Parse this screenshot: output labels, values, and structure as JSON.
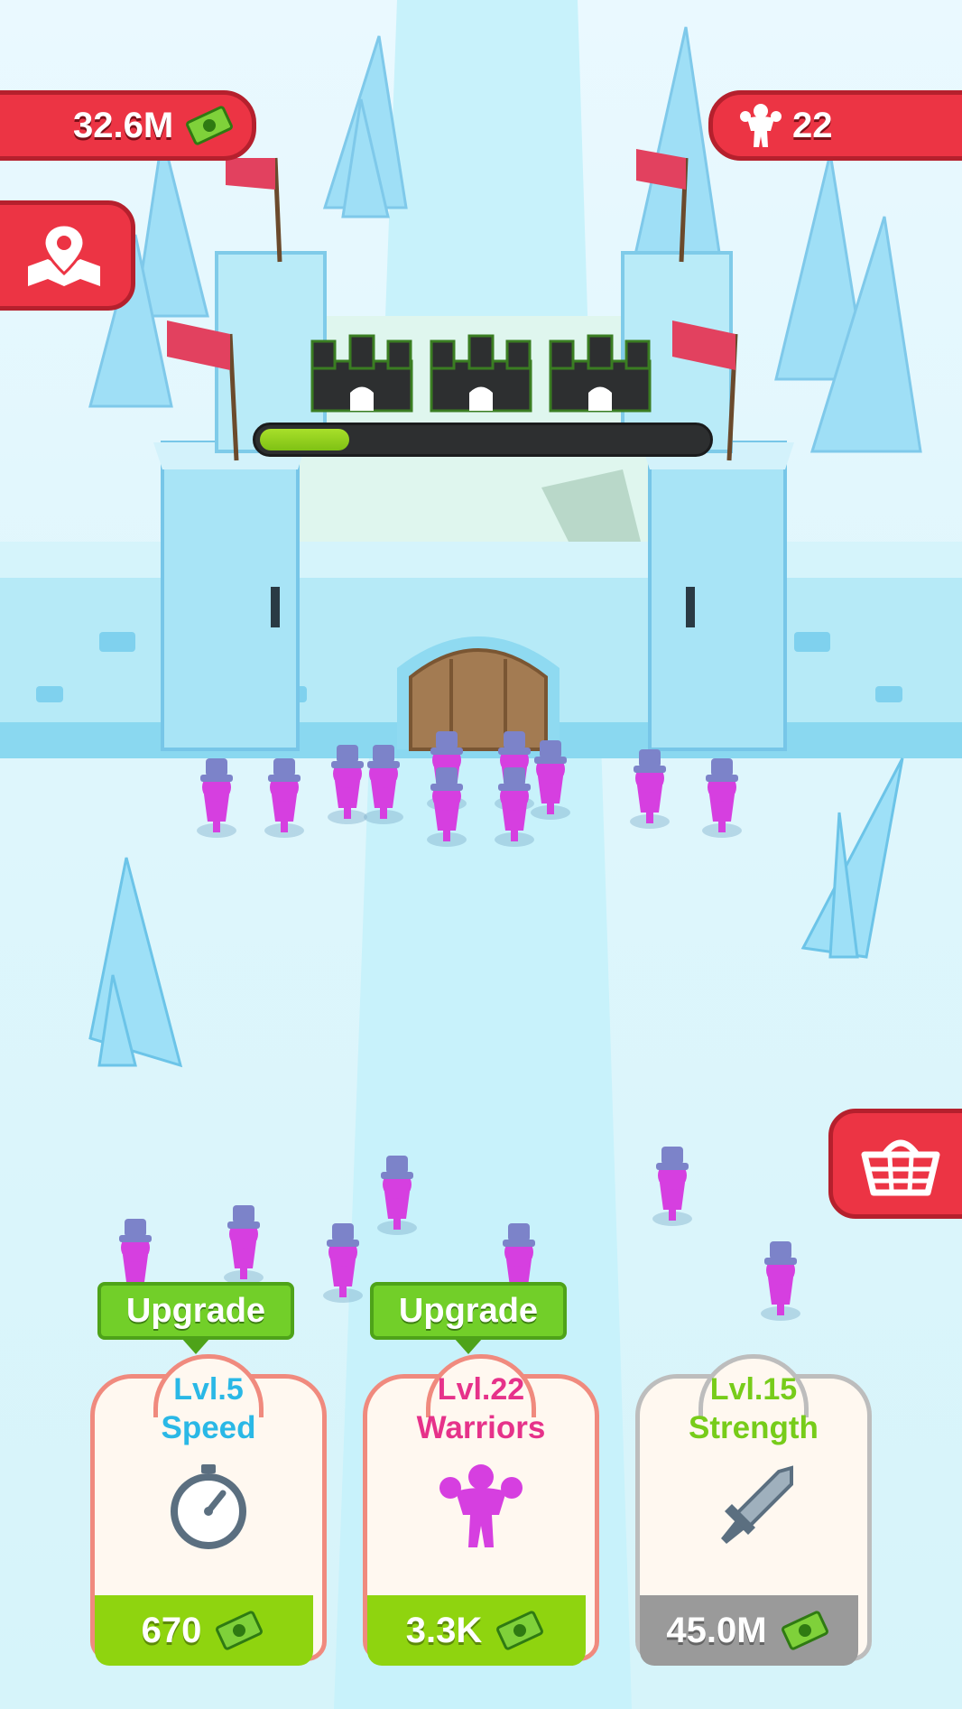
{
  "hud": {
    "money": "32.6M",
    "warriors_count": "22"
  },
  "castle_progress": {
    "fraction": 0.2
  },
  "upgrade_labels": [
    "Upgrade",
    "Upgrade"
  ],
  "cards": [
    {
      "level": "Lvl.5",
      "name": "Speed",
      "price": "670",
      "icon": "stopwatch-icon",
      "theme": "#2ab8e6"
    },
    {
      "level": "Lvl.22",
      "name": "Warriors",
      "price": "3.3K",
      "icon": "warrior-icon",
      "theme": "#e6328a"
    },
    {
      "level": "Lvl.15",
      "name": "Strength",
      "price": "45.0M",
      "icon": "sword-icon",
      "theme": "#77cc1a"
    }
  ],
  "colors": {
    "hud_red": "#ec3444",
    "upgrade_green": "#72cf29",
    "price_green": "#8fd40f",
    "price_gray": "#9a9a9a"
  }
}
